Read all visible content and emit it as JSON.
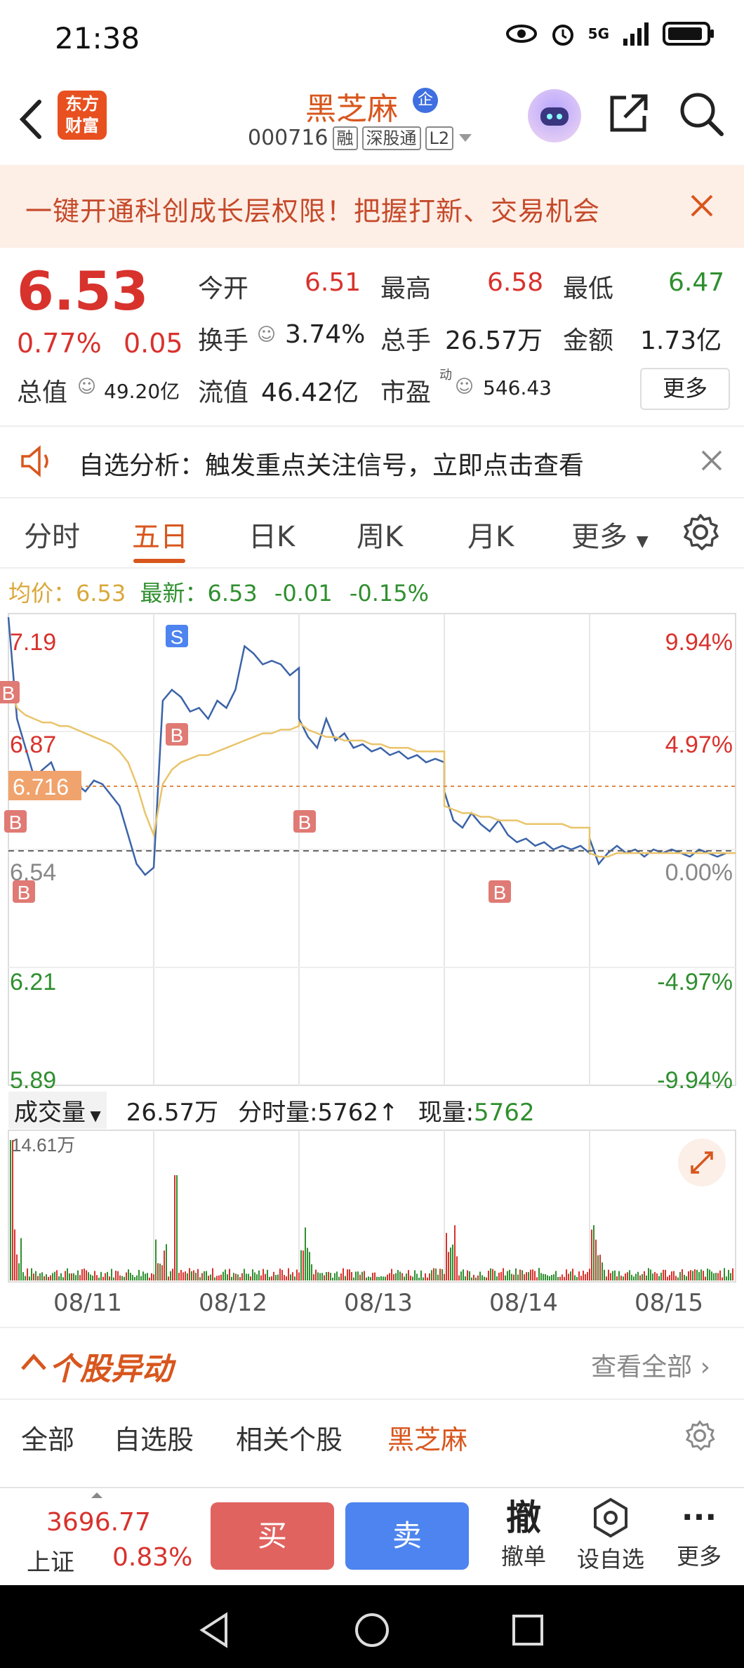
{
  "status_bar": {
    "time": "21:38",
    "network": "5G"
  },
  "header": {
    "logo_line1": "东方",
    "logo_line2": "财富",
    "stock_name": "黑芝麻",
    "badge": "企",
    "code": "000716",
    "tags": [
      "融",
      "深股通",
      "L2"
    ]
  },
  "banner": {
    "text": "一键开通科创成长层权限！把握打新、交易机会"
  },
  "quote": {
    "price": "6.53",
    "change_pct": "0.77%",
    "change": "0.05",
    "open_label": "今开",
    "open": "6.51",
    "high_label": "最高",
    "high": "6.58",
    "low_label": "最低",
    "low": "6.47",
    "turnover_label": "换手",
    "turnover": "3.74%",
    "volume_label": "总手",
    "volume": "26.57万",
    "amount_label": "金额",
    "amount": "1.73亿",
    "mcap_label": "总值",
    "mcap": "49.20亿",
    "float_label": "流值",
    "float": "46.42亿",
    "pe_label": "市盈",
    "pe_sup": "动",
    "pe": "546.43",
    "more": "更多"
  },
  "alert": {
    "text": "自选分析：触发重点关注信号，立即点击查看"
  },
  "tabs": [
    "分时",
    "五日",
    "日K",
    "周K",
    "月K",
    "更多"
  ],
  "active_tab": "五日",
  "avg_line": {
    "avg_label": "均价：",
    "avg": "6.53",
    "latest_label": "最新：",
    "latest": "6.53",
    "chg": "-0.01",
    "chg_pct": "-0.15%"
  },
  "chart_data": {
    "type": "line",
    "y_left_ticks": [
      "7.19",
      "6.87",
      "6.54",
      "6.21",
      "5.89"
    ],
    "y_right_ticks": [
      "9.94%",
      "4.97%",
      "0.00%",
      "-4.97%",
      "-9.94%"
    ],
    "ylim": [
      5.89,
      7.19
    ],
    "marker_price": "6.716",
    "x_labels": [
      "08/11",
      "08/12",
      "08/13",
      "08/14",
      "08/15"
    ],
    "signals": [
      "B",
      "B",
      "B",
      "S",
      "B",
      "B",
      "B"
    ]
  },
  "volume": {
    "selector": "成交量",
    "total": "26.57万",
    "tick_label": "分时量:5762↑",
    "now_label": "现量:",
    "now": "5762",
    "max_label": "14.61万"
  },
  "section": {
    "title": "个股异动",
    "link": "查看全部"
  },
  "subtabs": [
    "全部",
    "自选股",
    "相关个股",
    "黑芝麻"
  ],
  "bottom": {
    "index_value": "3696.77",
    "index_name": "上证",
    "index_pct": "0.83%",
    "buy": "买",
    "sell": "卖",
    "cancel_icon": "撤",
    "cancel": "撤单",
    "set_watch": "设自选",
    "more": "更多"
  }
}
